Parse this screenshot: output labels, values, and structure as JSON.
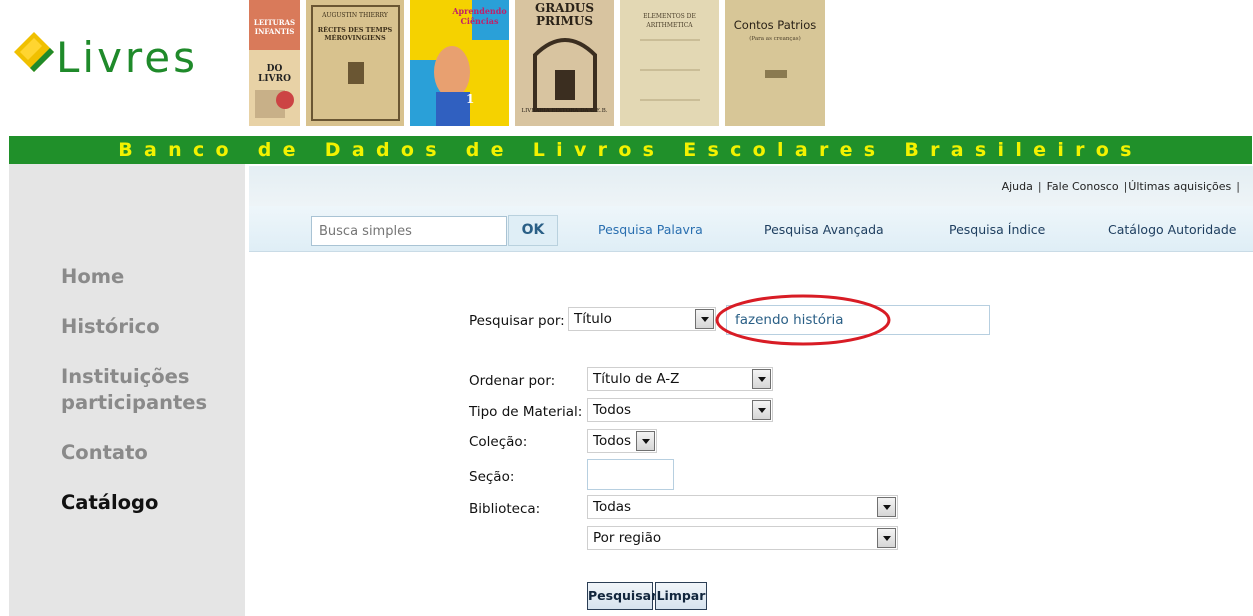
{
  "header": {
    "logo_text": "Livres",
    "banner_text": "Banco de Dados de Livros Escolares Brasileiros",
    "book_covers": [
      {
        "title": "LEITURAS INFANTIS",
        "subtitle": "DO LIVRO"
      },
      {
        "title": "AUGUSTIN THIERRY",
        "subtitle": "RÉCITS DES TEMPS MÉROVINGIENS"
      },
      {
        "title": "Aprendendo Ciências",
        "subtitle": "1"
      },
      {
        "title": "GRADUS PRIMUS",
        "subtitle": "LIVRARIA EDITORA DA C.E.B."
      },
      {
        "title": "ELEMENTOS DE ARITHMETICA",
        "subtitle": ""
      },
      {
        "title": "Contos Patrios",
        "subtitle": "(Para as creanças)"
      }
    ]
  },
  "sidebar": {
    "items": [
      {
        "label": "Home",
        "active": false
      },
      {
        "label": "Histórico",
        "active": false
      },
      {
        "label": "Instituições participantes",
        "active": false
      },
      {
        "label": "Contato",
        "active": false
      },
      {
        "label": "Catálogo",
        "active": true
      }
    ]
  },
  "utility": {
    "links": [
      "Ajuda",
      "Fale Conosco",
      "Últimas aquisições"
    ]
  },
  "searchbar": {
    "placeholder": "Busca simples",
    "ok_label": "OK",
    "links": [
      "Pesquisa Palavra",
      "Pesquisa Avançada",
      "Pesquisa Índice",
      "Catálogo Autoridade"
    ]
  },
  "form": {
    "search_by_label": "Pesquisar por:",
    "search_by_value": "Título",
    "search_text": "fazendo história",
    "order_label": "Ordenar por:",
    "order_value": "Título de A-Z",
    "material_label": "Tipo de Material:",
    "material_value": "Todos",
    "collection_label": "Coleção:",
    "collection_value": "Todos",
    "section_label": "Seção:",
    "section_value": "",
    "library_label": "Biblioteca:",
    "library_value": "Todas",
    "region_value": "Por região",
    "search_button": "Pesquisar",
    "clear_button": "Limpar"
  },
  "colors": {
    "brand_green": "#20902a",
    "banner_text": "#f2f200",
    "highlight": "#d81c25"
  }
}
